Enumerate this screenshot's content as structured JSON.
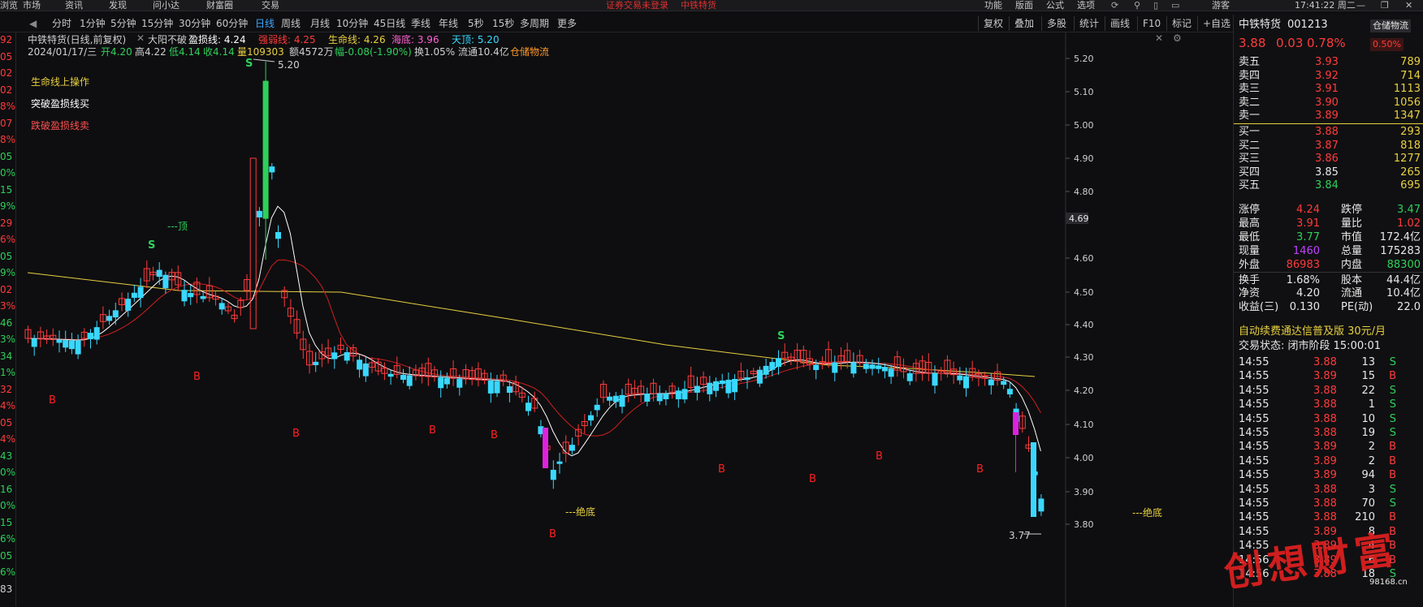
{
  "topbar": {
    "left_menu": [
      "浏览",
      "市场",
      "资讯",
      "发现",
      "问小达",
      "财富圈",
      "交易"
    ],
    "center_warning": "证券交易未登录",
    "center_stock": "中铁特货",
    "right_menu": [
      "功能",
      "版面",
      "公式",
      "选项"
    ],
    "user": "游客",
    "clock": "17:41:22 周二"
  },
  "periods": [
    "分时",
    "1分钟",
    "5分钟",
    "15分钟",
    "30分钟",
    "60分钟",
    "日线",
    "周线",
    "月线",
    "10分钟",
    "45日线",
    "季线",
    "年线",
    "5秒",
    "15秒",
    "多周期",
    "更多"
  ],
  "active_period": "日线",
  "chart_tools": [
    "复权",
    "叠加",
    "多股",
    "统计",
    "画线",
    "F10",
    "标记",
    "+自选",
    "返回"
  ],
  "left_edge_values": [
    {
      "t": "92",
      "c": "red"
    },
    {
      "t": "05",
      "c": "red"
    },
    {
      "t": "02",
      "c": "red"
    },
    {
      "t": "02",
      "c": "red"
    },
    {
      "t": "8%",
      "c": "red"
    },
    {
      "t": "07",
      "c": "red"
    },
    {
      "t": "8%",
      "c": "red"
    },
    {
      "t": "05",
      "c": "green"
    },
    {
      "t": "0%",
      "c": "green"
    },
    {
      "t": "15",
      "c": "green"
    },
    {
      "t": "9%",
      "c": "green"
    },
    {
      "t": "29",
      "c": "red"
    },
    {
      "t": "6%",
      "c": "red"
    },
    {
      "t": "05",
      "c": "green"
    },
    {
      "t": "9%",
      "c": "green"
    },
    {
      "t": "02",
      "c": "red"
    },
    {
      "t": "3%",
      "c": "red"
    },
    {
      "t": "46",
      "c": "green"
    },
    {
      "t": "3%",
      "c": "green"
    },
    {
      "t": "34",
      "c": "green"
    },
    {
      "t": "1%",
      "c": "green"
    },
    {
      "t": "32",
      "c": "red"
    },
    {
      "t": "4%",
      "c": "red"
    },
    {
      "t": "05",
      "c": "red"
    },
    {
      "t": "4%",
      "c": "red"
    },
    {
      "t": "43",
      "c": "green"
    },
    {
      "t": "0%",
      "c": "green"
    },
    {
      "t": "16",
      "c": "green"
    },
    {
      "t": "0%",
      "c": "green"
    },
    {
      "t": "15",
      "c": "green"
    },
    {
      "t": "6%",
      "c": "green"
    },
    {
      "t": "05",
      "c": "green"
    },
    {
      "t": "6%",
      "c": "green"
    },
    {
      "t": "83",
      "c": "white"
    }
  ],
  "chart": {
    "title_line1": "中铁特货(日线,前复权)",
    "indicator_name": "大阳不破",
    "profit_line": "盈损线: 4.24",
    "strong_weak": "强弱线: 4.25",
    "life_line": "生命线: 4.26",
    "sea_bottom": "海底: 3.96",
    "sky_top": "天顶: 5.20",
    "date": "2024/01/17/三",
    "open": "开4.20",
    "high": "高4.22",
    "low": "低4.14",
    "close": "收4.14",
    "volume": "量109303",
    "amount": "额4572万",
    "change": "幅-0.08(-1.90%)",
    "turnover": "换1.05%",
    "float_cap": "流通10.4亿",
    "sector": "仓储物流",
    "legend_life": "生命线上操作",
    "legend_break": "突破盈损线买",
    "legend_fall": "跌破盈损线卖",
    "top_label": "---顶",
    "bottom_label1": "---绝底",
    "bottom_label2": "---绝底",
    "high_mark": "5.20",
    "low_mark": "3.77",
    "cursor_price": "4.69",
    "y_ticks": [
      "5.20",
      "5.10",
      "5.00",
      "4.90",
      "4.80",
      "4.60",
      "4.50",
      "4.40",
      "4.30",
      "4.20",
      "4.10",
      "4.00",
      "3.90",
      "3.80"
    ],
    "b_marks": [
      "B",
      "B",
      "B",
      "B",
      "B",
      "B",
      "B",
      "B",
      "B",
      "B"
    ],
    "s_marks": [
      "S",
      "S",
      "S"
    ]
  },
  "quote": {
    "name": "中铁特货",
    "code": "001213",
    "badge": "仓储物流",
    "price": "3.88",
    "change": "0.03",
    "pct": "0.78%",
    "badge_pct": "0.50%",
    "asks": [
      {
        "label": "卖五",
        "price": "3.93",
        "vol": "789"
      },
      {
        "label": "卖四",
        "price": "3.92",
        "vol": "714"
      },
      {
        "label": "卖三",
        "price": "3.91",
        "vol": "1113"
      },
      {
        "label": "卖二",
        "price": "3.90",
        "vol": "1056"
      },
      {
        "label": "卖一",
        "price": "3.89",
        "vol": "1347"
      }
    ],
    "bids": [
      {
        "label": "买一",
        "price": "3.88",
        "vol": "293"
      },
      {
        "label": "买二",
        "price": "3.87",
        "vol": "818"
      },
      {
        "label": "买三",
        "price": "3.86",
        "vol": "1277"
      },
      {
        "label": "买四",
        "price": "3.85",
        "vol": "265"
      },
      {
        "label": "买五",
        "price": "3.84",
        "vol": "695"
      }
    ],
    "stats": [
      {
        "l1": "涨停",
        "v1": "4.24",
        "c1": "red",
        "l2": "跌停",
        "v2": "3.47",
        "c2": "green"
      },
      {
        "l1": "最高",
        "v1": "3.91",
        "c1": "red",
        "l2": "量比",
        "v2": "1.02",
        "c2": "red"
      },
      {
        "l1": "最低",
        "v1": "3.77",
        "c1": "green",
        "l2": "市值",
        "v2": "172.4亿",
        "c2": "white"
      },
      {
        "l1": "现量",
        "v1": "1460",
        "c1": "purple",
        "l2": "总量",
        "v2": "175283",
        "c2": "white"
      },
      {
        "l1": "外盘",
        "v1": "86983",
        "c1": "red",
        "l2": "内盘",
        "v2": "88300",
        "c2": "green"
      },
      {
        "l1": "换手",
        "v1": "1.68%",
        "c1": "white",
        "l2": "股本",
        "v2": "44.4亿",
        "c2": "white"
      },
      {
        "l1": "净资",
        "v1": "4.20",
        "c1": "white",
        "l2": "流通",
        "v2": "10.4亿",
        "c2": "white"
      },
      {
        "l1": "收益(三)",
        "v1": "0.130",
        "c1": "white",
        "l2": "PE(动)",
        "v2": "22.0",
        "c2": "white"
      }
    ],
    "ad": "自动续费通达信普及版  30元/月",
    "status": "交易状态: 闭市阶段 15:00:01",
    "ticks": [
      {
        "t": "14:55",
        "p": "3.88",
        "v": "13",
        "s": "S"
      },
      {
        "t": "14:55",
        "p": "3.89",
        "v": "15",
        "s": "B"
      },
      {
        "t": "14:55",
        "p": "3.88",
        "v": "22",
        "s": "S"
      },
      {
        "t": "14:55",
        "p": "3.88",
        "v": "1",
        "s": "S"
      },
      {
        "t": "14:55",
        "p": "3.88",
        "v": "10",
        "s": "S"
      },
      {
        "t": "14:55",
        "p": "3.88",
        "v": "19",
        "s": "S"
      },
      {
        "t": "14:55",
        "p": "3.89",
        "v": "2",
        "s": "B"
      },
      {
        "t": "14:55",
        "p": "3.89",
        "v": "2",
        "s": "B"
      },
      {
        "t": "14:55",
        "p": "3.89",
        "v": "94",
        "s": "B"
      },
      {
        "t": "14:55",
        "p": "3.88",
        "v": "3",
        "s": "S"
      },
      {
        "t": "14:55",
        "p": "3.88",
        "v": "70",
        "s": "S"
      },
      {
        "t": "14:55",
        "p": "3.88",
        "v": "210",
        "s": "B"
      },
      {
        "t": "14:55",
        "p": "3.89",
        "v": "8",
        "s": "B"
      },
      {
        "t": "14:55",
        "p": "3.89",
        "v": "4",
        "s": "B"
      },
      {
        "t": "14:56",
        "p": "3.89",
        "v": "6",
        "s": "B"
      },
      {
        "t": "14:56",
        "p": "3.88",
        "v": "18",
        "s": "S"
      }
    ]
  },
  "watermark": {
    "text": "创想财富",
    "small": "98168.cn"
  }
}
